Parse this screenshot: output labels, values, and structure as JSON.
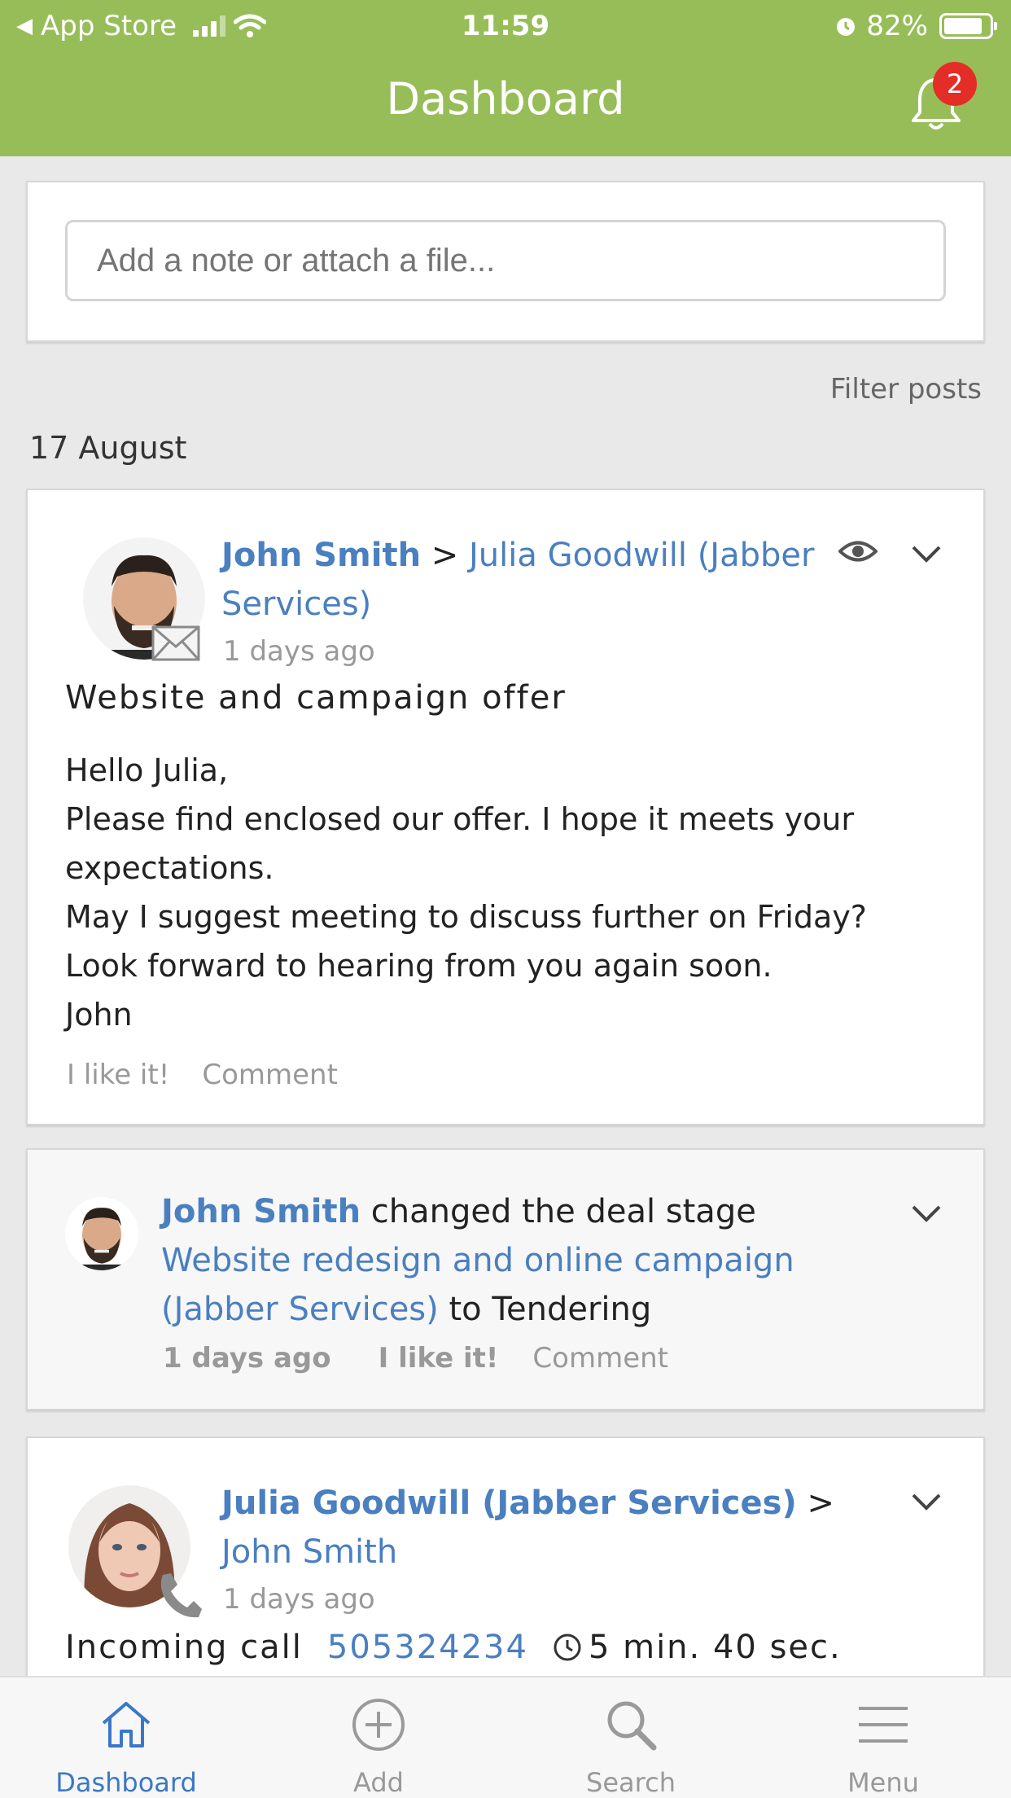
{
  "status_bar": {
    "back_label": "App Store",
    "time": "11:59",
    "battery": "82%",
    "battery_level": 0.82
  },
  "header": {
    "title": "Dashboard",
    "notification_count": "2"
  },
  "composer": {
    "placeholder": "Add a note or attach a file..."
  },
  "feed": {
    "filter_label": "Filter posts",
    "date": "17 August",
    "posts": [
      {
        "author": "John Smith",
        "separator": ">",
        "recipient": "Julia Goodwill (Jabber Services)",
        "time": "1 days ago",
        "subject": "Website and campaign offer",
        "body": [
          "Hello Julia,",
          "Please find enclosed our offer. I hope it meets your",
          "expectations.",
          "May I suggest meeting to discuss further on Friday?",
          "Look forward to hearing from you again soon.",
          "John"
        ],
        "like_label": "I like it!",
        "comment_label": "Comment",
        "type_icon": "envelope-icon"
      },
      {
        "author": "John Smith",
        "action_text": "changed the deal stage",
        "deal": "Website redesign and online campaign (Jabber Services)",
        "to_text": "to Tendering",
        "time": "1 days ago",
        "like_label": "I like it!",
        "comment_label": "Comment"
      },
      {
        "author": "Julia Goodwill (Jabber Services)",
        "separator": ">",
        "recipient": "John Smith",
        "time": "1 days ago",
        "call_label": "Incoming call",
        "phone": "505324234",
        "duration": "5 min. 40 sec.",
        "type_icon": "phone-icon"
      }
    ]
  },
  "tabbar": {
    "items": [
      {
        "label": "Dashboard",
        "icon": "home-icon",
        "active": true
      },
      {
        "label": "Add",
        "icon": "add-circle-icon",
        "active": false
      },
      {
        "label": "Search",
        "icon": "search-icon",
        "active": false
      },
      {
        "label": "Menu",
        "icon": "menu-icon",
        "active": false
      }
    ]
  },
  "colors": {
    "header": "#97bd59",
    "link": "#4a7fc0",
    "badge": "#e52d27",
    "active_tab": "#3a78c6"
  }
}
